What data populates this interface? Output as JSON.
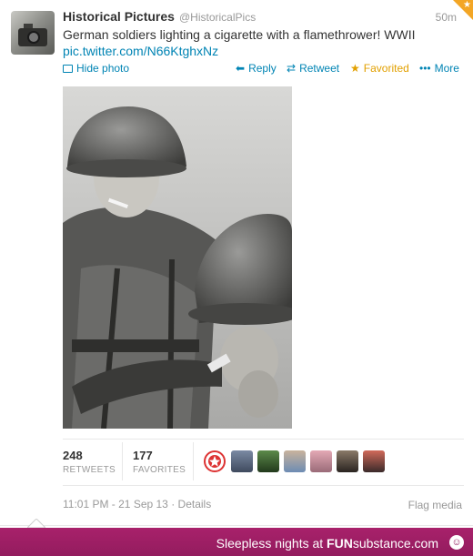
{
  "tweet": {
    "display_name": "Historical Pictures",
    "handle": "@HistoricalPics",
    "age": "50m",
    "text": "German soldiers lighting a cigarette with a flamethrower! WWII",
    "link": "pic.twitter.com/N66KtghxNz",
    "actions": {
      "hide": "Hide photo",
      "reply": "Reply",
      "retweet": "Retweet",
      "favorited": "Favorited",
      "more": "More"
    },
    "stats": {
      "retweets_count": "248",
      "retweets_label": "RETWEETS",
      "favorites_count": "177",
      "favorites_label": "FAVORITES"
    },
    "timestamp": "11:01 PM - 21 Sep 13",
    "details_link": "Details",
    "flag_media": "Flag media"
  },
  "footer": {
    "caption_prefix": "Sleepless nights at ",
    "brand_fun": "FUN",
    "brand_substance": "substance",
    "brand_com": ".com"
  },
  "colors": {
    "link": "#0084b4",
    "favorited": "#e2a000",
    "footer_bg": "#931c5e"
  }
}
